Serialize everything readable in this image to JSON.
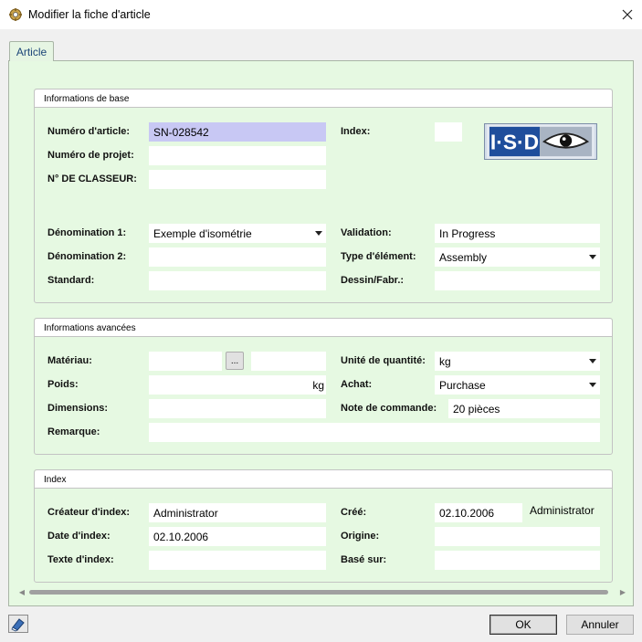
{
  "window": {
    "title": "Modifier la fiche d'article"
  },
  "tab": {
    "label": "Article"
  },
  "basic": {
    "header": "Informations de base",
    "article_number_label": "Numéro d'article:",
    "article_number": "SN-028542",
    "project_number_label": "Numéro de projet:",
    "project_number": "",
    "binder_label": "N° DE CLASSEUR:",
    "binder": "",
    "index_label": "Index:",
    "index": "",
    "logo_text": "I·S·D",
    "designation1_label": "Dénomination 1:",
    "designation1": "Exemple d'isométrie",
    "designation2_label": "Dénomination 2:",
    "designation2": "",
    "standard_label": "Standard:",
    "standard": "",
    "validation_label": "Validation:",
    "validation": "In Progress",
    "element_type_label": "Type d'élément:",
    "element_type": "Assembly",
    "drawing_label": "Dessin/Fabr.:",
    "drawing": ""
  },
  "advanced": {
    "header": "Informations avancées",
    "material_label": "Matériau:",
    "material": "",
    "material_extra": "",
    "browse_label": "...",
    "weight_label": "Poids:",
    "weight": "",
    "weight_unit": "kg",
    "dimensions_label": "Dimensions:",
    "dimensions": "",
    "remark_label": "Remarque:",
    "remark": "",
    "qty_unit_label": "Unité de quantité:",
    "qty_unit": "kg",
    "purchase_label": "Achat:",
    "purchase": "Purchase",
    "order_note_label": "Note de commande:",
    "order_note": "20 pièces"
  },
  "index": {
    "header": "Index",
    "creator_label": "Créateur d'index:",
    "creator": "Administrator",
    "date_label": "Date d'index:",
    "date": "02.10.2006",
    "text_label": "Texte d'index:",
    "text": "",
    "created_label": "Créé:",
    "created_date": "02.10.2006",
    "created_by": "Administrator",
    "origin_label": "Origine:",
    "origin": "",
    "based_on_label": "Basé sur:",
    "based_on": ""
  },
  "buttons": {
    "ok": "OK",
    "cancel": "Annuler"
  },
  "icons": {
    "app": "gear-icon",
    "close": "close-icon",
    "help": "eraser-icon"
  },
  "colors": {
    "panel_bg": "#e6f9e2",
    "highlight_field": "#c8c8f4"
  }
}
